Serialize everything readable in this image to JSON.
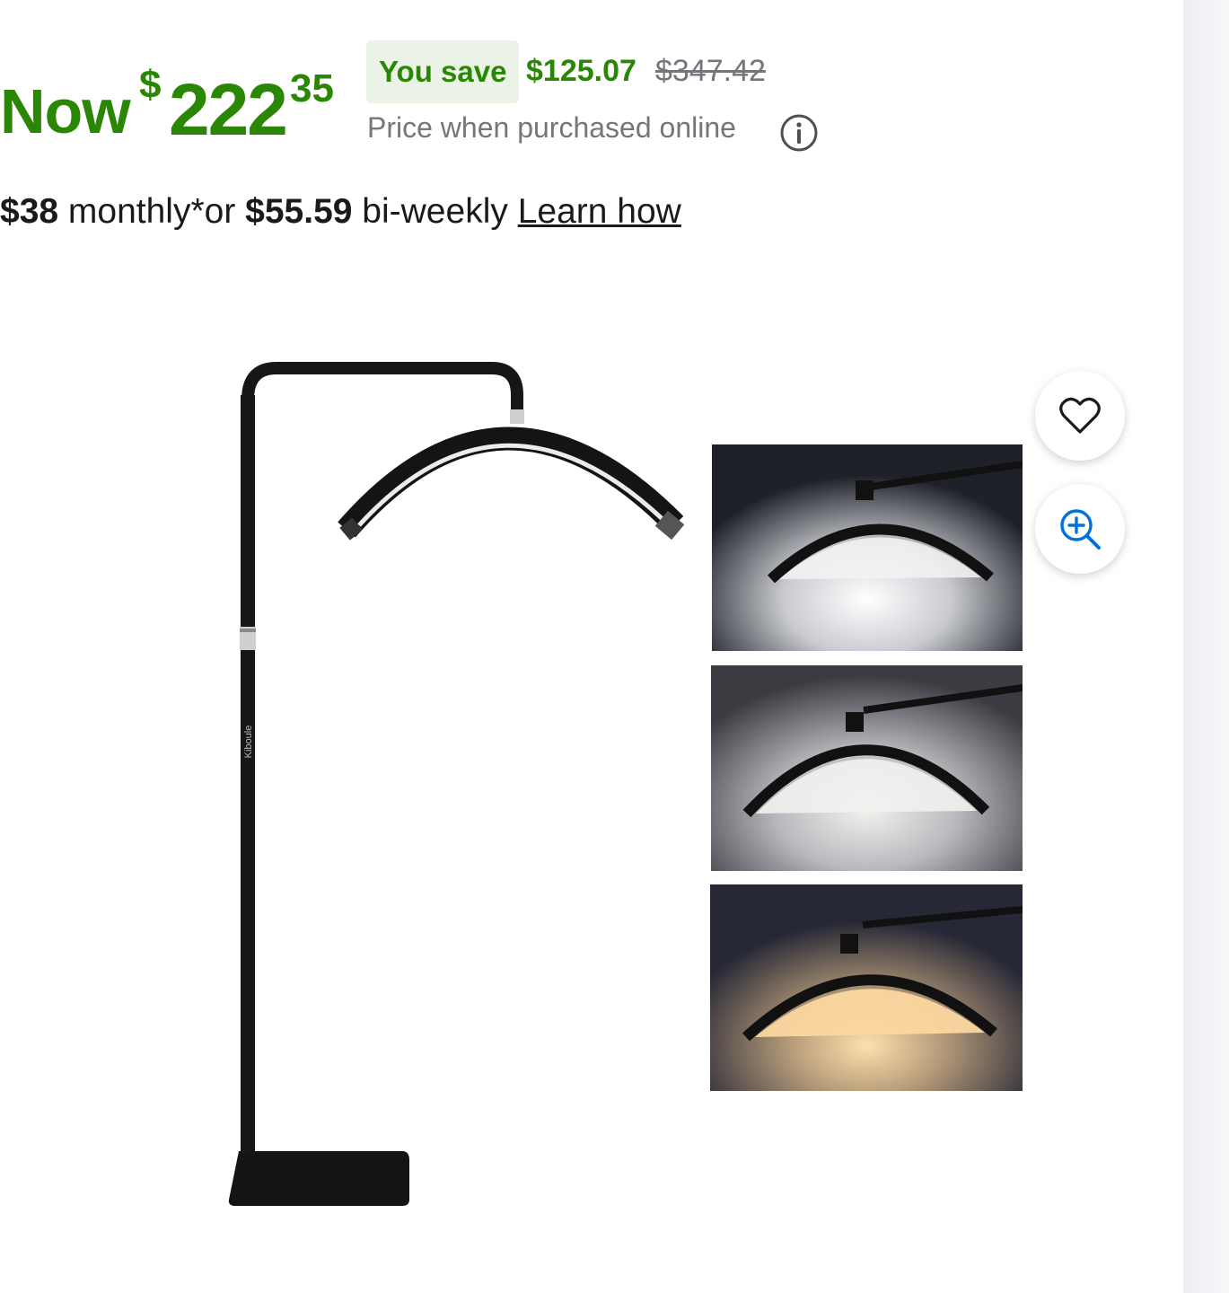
{
  "price": {
    "now_label": "Now",
    "currency_symbol": "$",
    "whole": "222",
    "cents": "35",
    "save_label": "You save",
    "save_amount": "$125.07",
    "was_price": "$347.42",
    "note": "Price when purchased online"
  },
  "financing": {
    "monthly_amount": "$38",
    "monthly_text": " monthly*or ",
    "biweekly_amount": "$55.59",
    "biweekly_text": " bi-weekly ",
    "learn_link": "Learn how"
  },
  "image": {
    "brand_text": "Kiboule",
    "thumbnail_tones": [
      "cool-white",
      "neutral-white",
      "warm-white"
    ]
  },
  "actions": {
    "favorite_icon": "heart-icon",
    "zoom_icon": "zoom-in-icon"
  },
  "colors": {
    "price_green": "#2a8703",
    "save_badge_bg": "#eaf3e6",
    "muted_text": "#74767c",
    "action_blue": "#0071dc"
  }
}
